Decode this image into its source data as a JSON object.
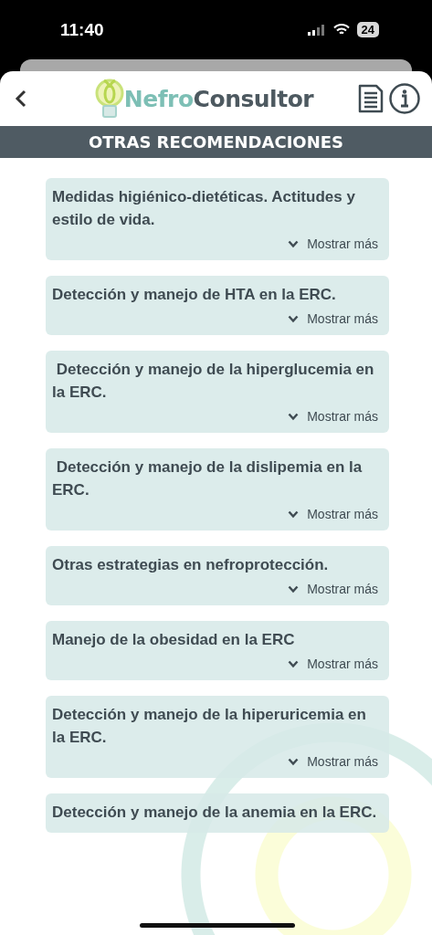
{
  "status_bar": {
    "time": "11:40",
    "battery": "24"
  },
  "header": {
    "logo_part_1": "Nefro",
    "logo_part_2": "Consultor"
  },
  "section_title": "OTRAS RECOMENDACIONES",
  "cards": [
    {
      "title": "Medidas higiénico-dietéticas. Actitudes y estilo de vida.",
      "more_label": "Mostrar más"
    },
    {
      "title": "Detección y manejo de HTA en la ERC.",
      "more_label": "Mostrar más"
    },
    {
      "title": " Detección y manejo de la hiperglucemia en la ERC.",
      "more_label": "Mostrar más"
    },
    {
      "title": " Detección y manejo de la dislipemia en la ERC.",
      "more_label": "Mostrar más"
    },
    {
      "title": "Otras estrategias en nefroprotección.",
      "more_label": "Mostrar más"
    },
    {
      "title": "Manejo de la obesidad en la ERC",
      "more_label": "Mostrar más"
    },
    {
      "title": "Detección y manejo de la hiperuricemia en la ERC.",
      "more_label": "Mostrar más"
    },
    {
      "title": "Detección y manejo de la anemia en la ERC."
    }
  ]
}
